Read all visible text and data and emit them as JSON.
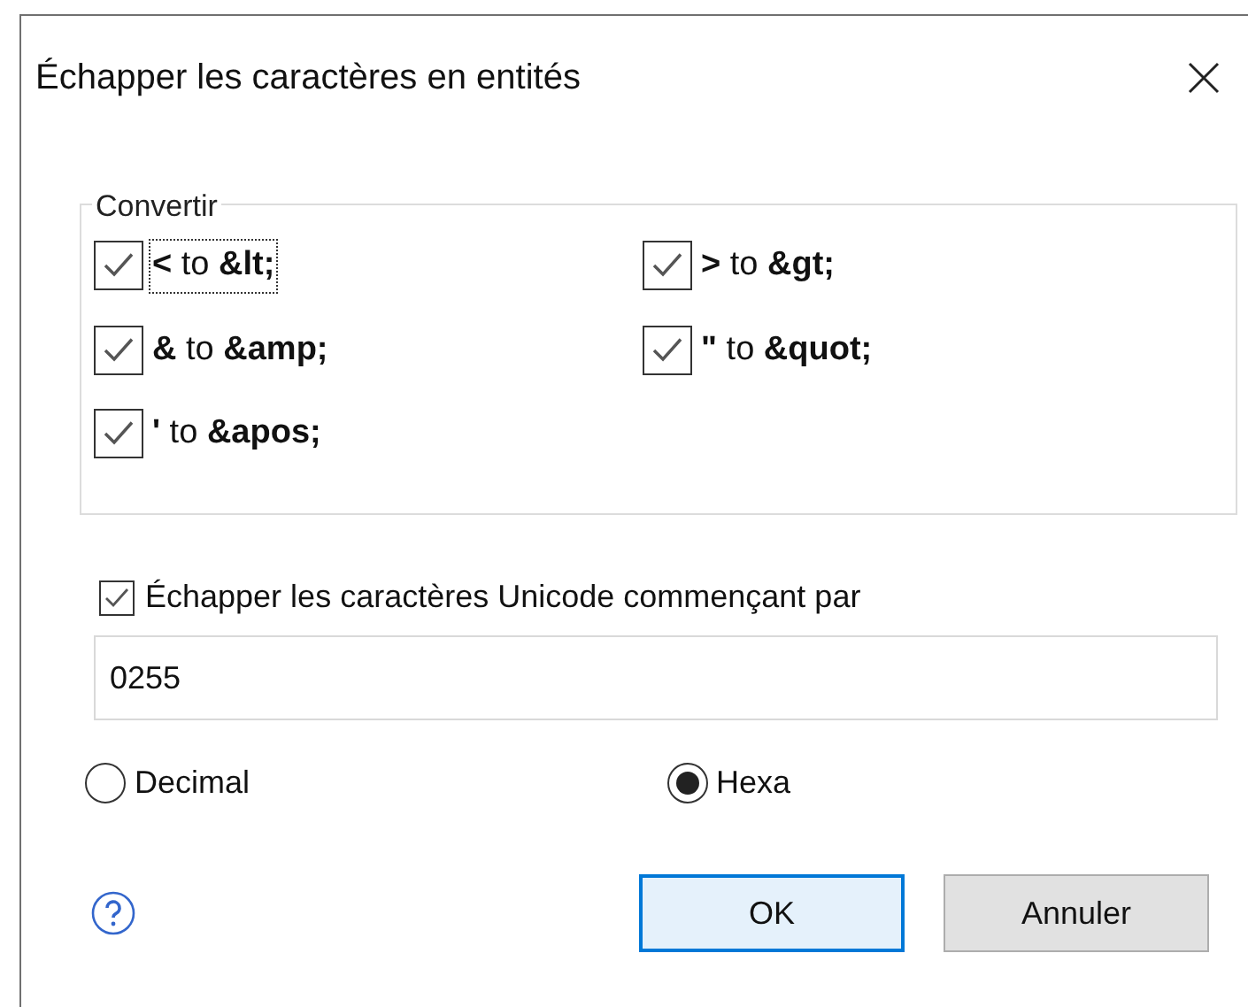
{
  "window": {
    "title": "Échapper les caractères en entités"
  },
  "convert_group": {
    "title": "Convertir",
    "options": [
      {
        "label": "**<** to **&lt;**",
        "checked": true,
        "focused": true
      },
      {
        "label": "**>** to **&gt;**",
        "checked": true,
        "focused": false
      },
      {
        "label": "**&** to **&amp;**",
        "checked": true,
        "focused": false
      },
      {
        "label": "**\"** to **&quot;**",
        "checked": true,
        "focused": false
      },
      {
        "label": "**'** to **&apos;**",
        "checked": true,
        "focused": false
      }
    ]
  },
  "unicode_option": {
    "label": "Échapper les caractères Unicode commençant par",
    "checked": true
  },
  "unicode_field": {
    "value": "0255"
  },
  "radios": [
    {
      "label": "Decimal",
      "selected": false
    },
    {
      "label": "Hexa",
      "selected": true
    }
  ],
  "buttons": [
    {
      "label": "OK",
      "kind": "default"
    },
    {
      "label": "Annuler",
      "kind": "normal"
    }
  ]
}
